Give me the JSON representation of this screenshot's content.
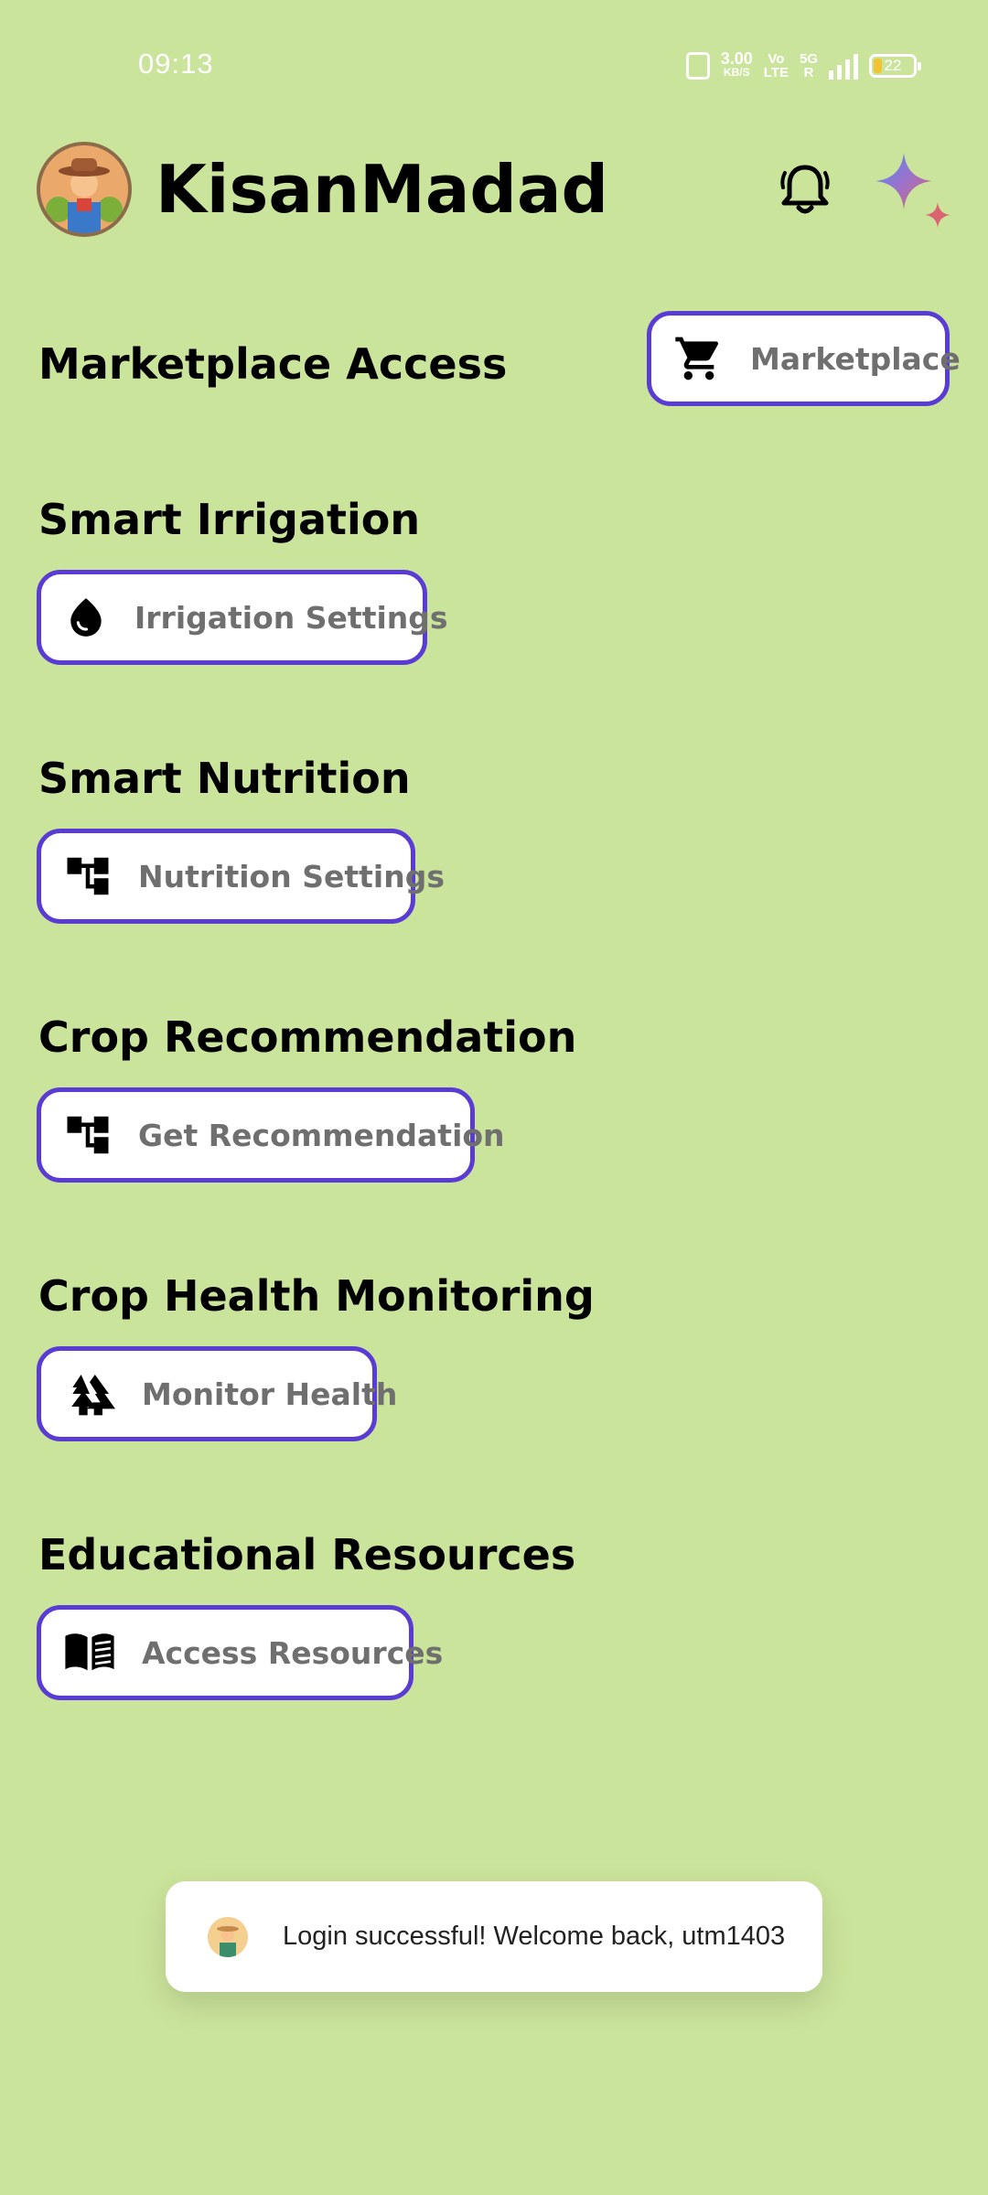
{
  "status_bar": {
    "time": "09:13",
    "net_speed": "3.00",
    "net_speed_unit": "KB/S",
    "volte_top": "Vo",
    "volte_bottom": "LTE",
    "fiveg_top": "5G",
    "fiveg_bottom": "R",
    "battery_level": "22"
  },
  "header": {
    "app_title": "KisanMadad"
  },
  "sections": [
    {
      "title": "Marketplace Access",
      "button_label": "Marketplace",
      "icon": "cart-icon"
    },
    {
      "title": "Smart Irrigation",
      "button_label": "Irrigation Settings",
      "icon": "water-drop-icon"
    },
    {
      "title": "Smart Nutrition",
      "button_label": "Nutrition Settings",
      "icon": "account-tree-icon"
    },
    {
      "title": "Crop Recommendation",
      "button_label": "Get Recommendation",
      "icon": "account-tree-icon"
    },
    {
      "title": "Crop Health Monitoring",
      "button_label": "Monitor Health",
      "icon": "forest-icon"
    },
    {
      "title": "Educational Resources",
      "button_label": "Access Resources",
      "icon": "book-icon"
    }
  ],
  "toast": {
    "message": "Login successful! Welcome back, utm1403"
  },
  "colors": {
    "background": "#cbe49b",
    "button_border": "#5a3bd4",
    "button_label": "#6f6f6f"
  }
}
